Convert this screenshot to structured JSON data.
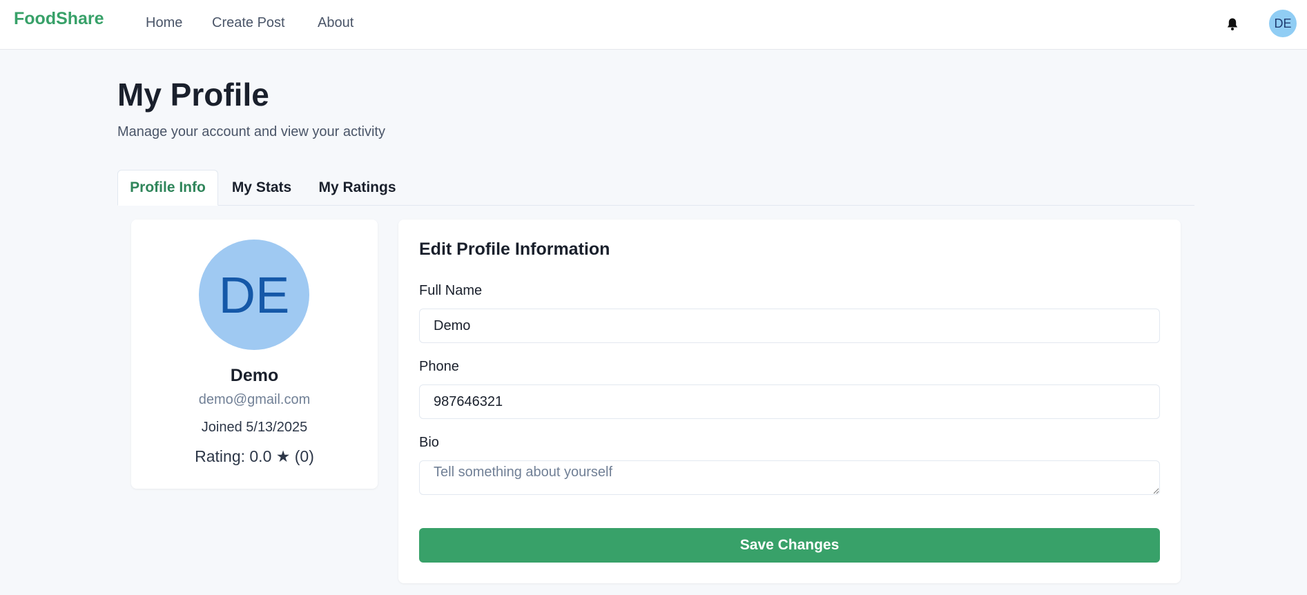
{
  "navbar": {
    "brand": "FoodShare",
    "links": [
      "Home",
      "Create Post",
      "About"
    ],
    "notification_icon": "bell-icon",
    "avatar_initials": "DE"
  },
  "header": {
    "title": "My Profile",
    "subtitle": "Manage your account and view your activity"
  },
  "tabs": [
    {
      "label": "Profile Info",
      "active": true
    },
    {
      "label": "My Stats",
      "active": false
    },
    {
      "label": "My Ratings",
      "active": false
    }
  ],
  "profile_card": {
    "avatar_initials": "DE",
    "name": "Demo",
    "email": "demo@gmail.com",
    "joined": "Joined 5/13/2025",
    "rating": "Rating: 0.0 ★ (0)"
  },
  "edit_form": {
    "title": "Edit Profile Information",
    "full_name_label": "Full Name",
    "full_name_value": "Demo",
    "phone_label": "Phone",
    "phone_value": "987646321",
    "bio_label": "Bio",
    "bio_value": "",
    "bio_placeholder": "Tell something about yourself",
    "save_label": "Save Changes"
  },
  "colors": {
    "brand": "#38a169",
    "active_tab": "#2f855a",
    "avatar_bg": "#9fc9f2",
    "avatar_text": "#1558a8",
    "page_bg": "#f6f8fb"
  }
}
